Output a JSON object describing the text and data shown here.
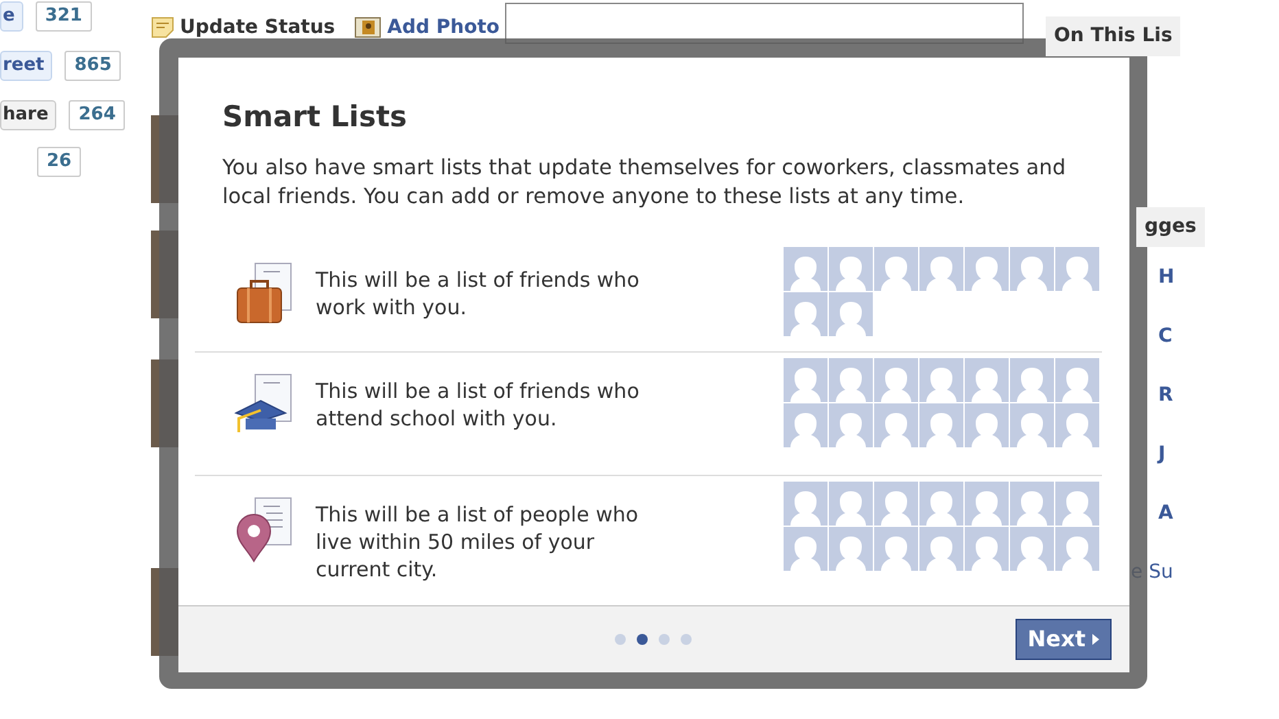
{
  "share_counters": [
    {
      "button": "e",
      "count": "321"
    },
    {
      "button": "reet",
      "count": "865"
    },
    {
      "button": "hare",
      "count": "264"
    },
    {
      "count": "26"
    }
  ],
  "composer": {
    "actions": [
      {
        "kind": "status",
        "label": "Update Status"
      },
      {
        "kind": "photo",
        "label": "Add Photo"
      }
    ]
  },
  "feed_photos": [
    {
      "kind": "photo"
    },
    {
      "kind": "photo"
    },
    {
      "kind": "photo"
    },
    {
      "kind": "photo"
    }
  ],
  "right_column": {
    "header": "On This Lis",
    "section_header": "gges",
    "items": [
      "H",
      "C",
      "R",
      "J",
      "A"
    ],
    "footer_link": "e Su"
  },
  "dialog": {
    "title": "Smart Lists",
    "description": "You also have smart lists that update themselves for coworkers, classmates and local friends. You can add or remove anyone to these lists at any time.",
    "lists": [
      {
        "kind": "work",
        "text": "This will be a list of friends who work with you.",
        "slots": [
          {
            "kind": "silhouette"
          },
          {
            "kind": "silhouette"
          },
          {
            "kind": "silhouette"
          },
          {
            "kind": "silhouette"
          },
          {
            "kind": "silhouette"
          },
          {
            "kind": "silhouette"
          },
          {
            "kind": "silhouette"
          },
          {
            "kind": "silhouette"
          },
          {
            "kind": "silhouette"
          }
        ]
      },
      {
        "kind": "school",
        "text": "This will be a list of friends who attend school with you.",
        "slots": [
          {
            "kind": "silhouette"
          },
          {
            "kind": "silhouette"
          },
          {
            "kind": "silhouette"
          },
          {
            "kind": "silhouette"
          },
          {
            "kind": "silhouette"
          },
          {
            "kind": "silhouette"
          },
          {
            "kind": "silhouette"
          },
          {
            "kind": "silhouette"
          },
          {
            "kind": "silhouette"
          },
          {
            "kind": "silhouette"
          },
          {
            "kind": "silhouette"
          },
          {
            "kind": "silhouette"
          },
          {
            "kind": "silhouette"
          },
          {
            "kind": "silhouette"
          }
        ]
      },
      {
        "kind": "location",
        "text": "This will be a list of people who live within 50 miles of your current city.",
        "slots": [
          {
            "kind": "silhouette"
          },
          {
            "kind": "silhouette"
          },
          {
            "kind": "silhouette"
          },
          {
            "kind": "silhouette"
          },
          {
            "kind": "silhouette"
          },
          {
            "kind": "silhouette"
          },
          {
            "kind": "silhouette"
          },
          {
            "kind": "silhouette"
          },
          {
            "kind": "silhouette"
          },
          {
            "kind": "silhouette"
          },
          {
            "kind": "silhouette"
          },
          {
            "kind": "silhouette"
          },
          {
            "kind": "silhouette"
          },
          {
            "kind": "silhouette"
          }
        ]
      }
    ],
    "steps": [
      {
        "selected": false
      },
      {
        "selected": true
      },
      {
        "selected": false
      },
      {
        "selected": false
      }
    ],
    "next_button": "Next"
  }
}
